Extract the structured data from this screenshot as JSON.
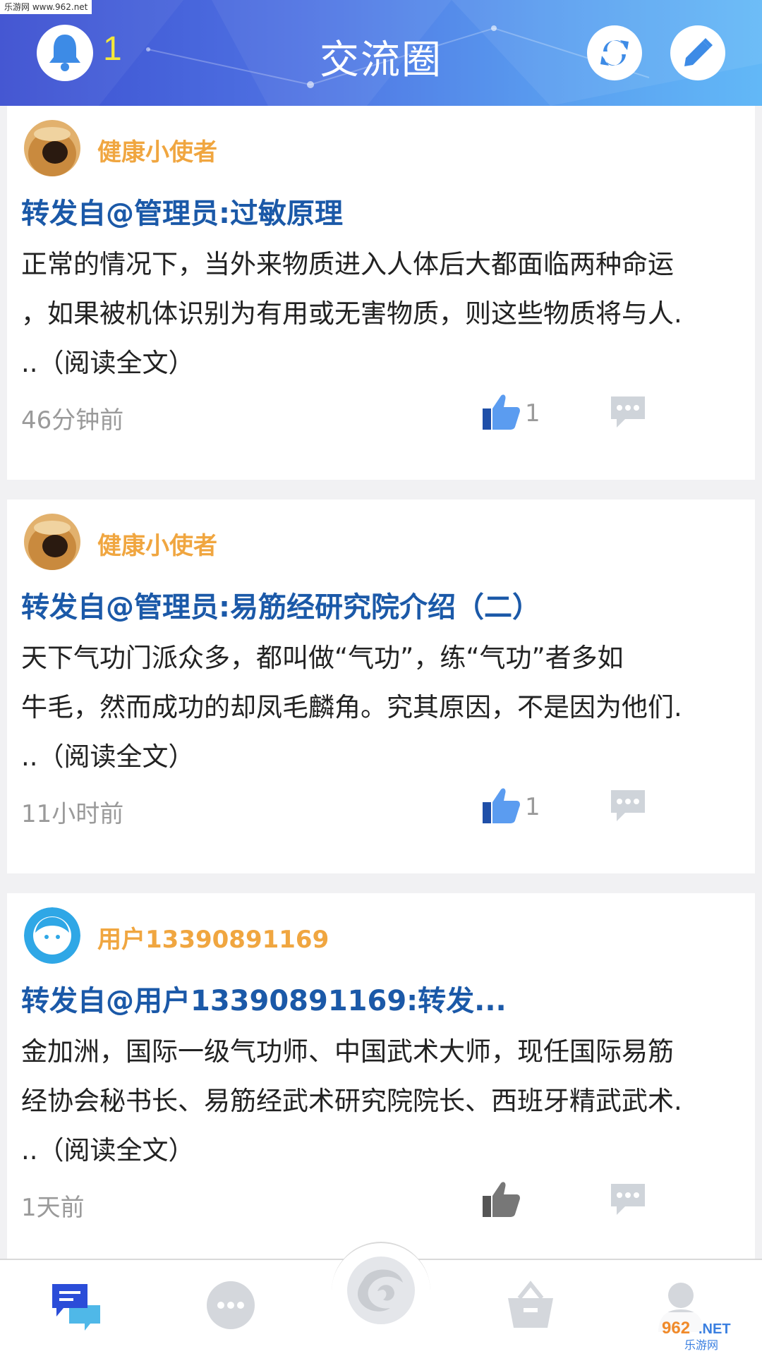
{
  "watermark_top": "乐游网 www.962.net",
  "header": {
    "title": "交流圈",
    "notification_count": "1"
  },
  "posts": [
    {
      "username": "健康小使者",
      "title": "转发自@管理员:过敏原理",
      "body_lines": [
        "正常的情况下，当外来物质进入人体后大都面临两种命运",
        "，如果被机体识别为有用或无害物质，则这些物质将与人.",
        "..（阅读全文）"
      ],
      "time": "46分钟前",
      "likes": "1"
    },
    {
      "username": "健康小使者",
      "title": "转发自@管理员:易筋经研究院介绍（二）",
      "body_lines": [
        "天下气功门派众多，都叫做“气功”，练“气功”者多如",
        "牛毛，然而成功的却凤毛麟角。究其原因，不是因为他们.",
        "..（阅读全文）"
      ],
      "time": "11小时前",
      "likes": "1"
    },
    {
      "username": "用户13390891169",
      "title": "转发自@用户13390891169:转发...",
      "body_lines": [
        "金加洲，国际一级气功师、中国武术大师，现任国际易筋",
        "经协会秘书长、易筋经武术研究院院长、西班牙精武武术.",
        "..（阅读全文）"
      ],
      "time": "1天前",
      "likes": ""
    }
  ],
  "tabs": [
    {
      "icon": "chat-bubbles-icon",
      "active": true
    },
    {
      "icon": "message-icon",
      "active": false
    },
    {
      "icon": "logo-icon",
      "active": false
    },
    {
      "icon": "basket-icon",
      "active": false
    },
    {
      "icon": "profile-icon",
      "active": false
    }
  ],
  "watermark_bottom": "962.NET 乐游网",
  "colors": {
    "header_start": "#3c4fd0",
    "header_end": "#62b8f7",
    "username": "#f0a640",
    "title": "#1b59a8",
    "like_active": "#3a7fe0",
    "tab_active": "#2b4dd8"
  }
}
